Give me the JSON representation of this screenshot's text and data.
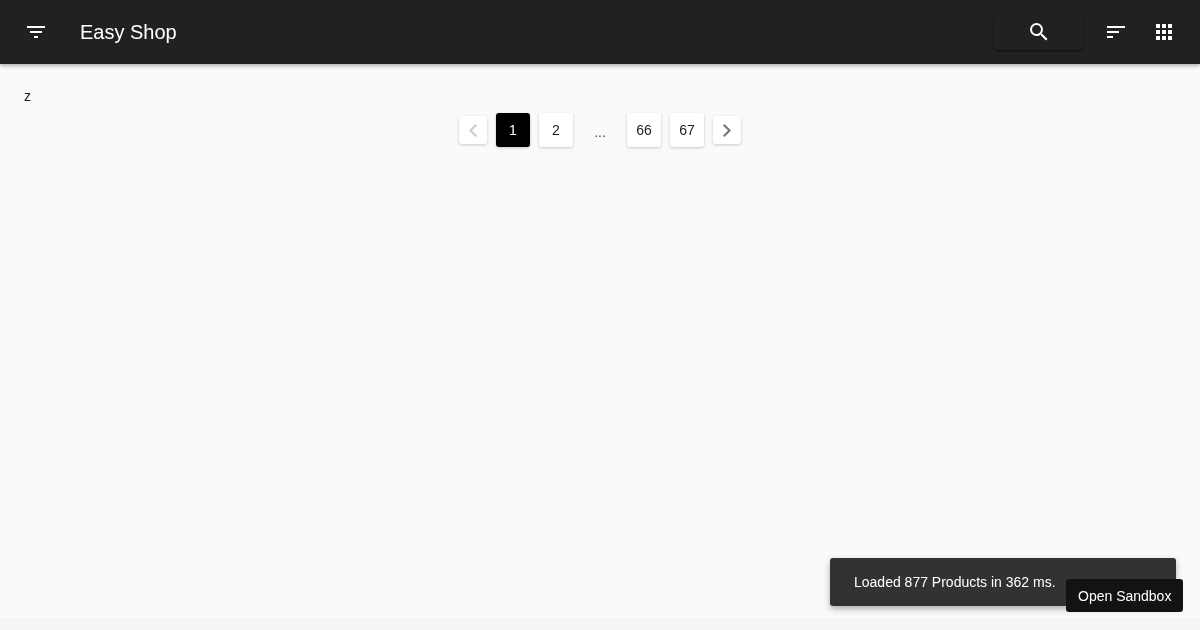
{
  "app_bar": {
    "title": "Easy Shop"
  },
  "query": "z",
  "pagination": [
    {
      "kind": "prev",
      "disabled": true
    },
    {
      "kind": "page",
      "label": "1",
      "selected": true
    },
    {
      "kind": "page",
      "label": "2",
      "selected": false
    },
    {
      "kind": "ellipsis",
      "label": "..."
    },
    {
      "kind": "page",
      "label": "66",
      "selected": false
    },
    {
      "kind": "page",
      "label": "67",
      "selected": false
    },
    {
      "kind": "next",
      "disabled": false
    }
  ],
  "snackbar": {
    "message": "Loaded 877 Products in 362 ms."
  },
  "sandbox_button": {
    "label": "Open Sandbox"
  }
}
